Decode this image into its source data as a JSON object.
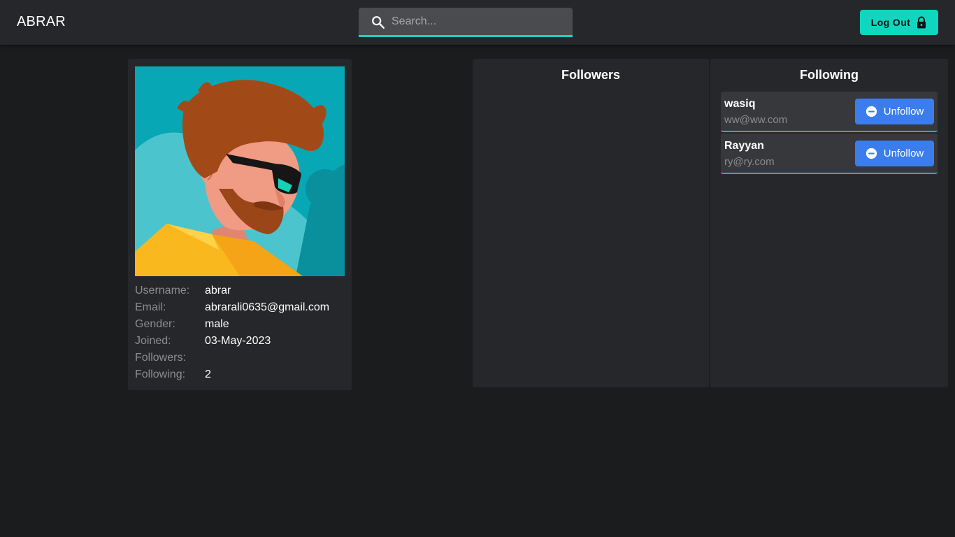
{
  "app": {
    "brand": "ABRAR"
  },
  "search": {
    "placeholder": "Search..."
  },
  "header": {
    "logout_label": "Log Out"
  },
  "profile": {
    "fields": [
      {
        "label": "Username:",
        "value": "abrar"
      },
      {
        "label": "Email:",
        "value": "abrarali0635@gmail.com"
      },
      {
        "label": "Gender:",
        "value": "male"
      },
      {
        "label": "Joined:",
        "value": "03-May-2023"
      },
      {
        "label": "Followers:",
        "value": ""
      },
      {
        "label": "Following:",
        "value": "2"
      }
    ]
  },
  "followers": {
    "title": "Followers",
    "items": []
  },
  "following": {
    "title": "Following",
    "items": [
      {
        "name": "wasiq",
        "email": "ww@ww.com",
        "action_label": "Unfollow"
      },
      {
        "name": "Rayyan",
        "email": "ry@ry.com",
        "action_label": "Unfollow"
      }
    ]
  },
  "colors": {
    "background": "#1b1c1e",
    "panel": "#26272a",
    "accent": "#10d6c0",
    "unfollow_button": "#3b7ded"
  },
  "icons": {
    "search": "search-icon",
    "logout": "lock-icon",
    "unfollow": "minus-circle-icon"
  }
}
